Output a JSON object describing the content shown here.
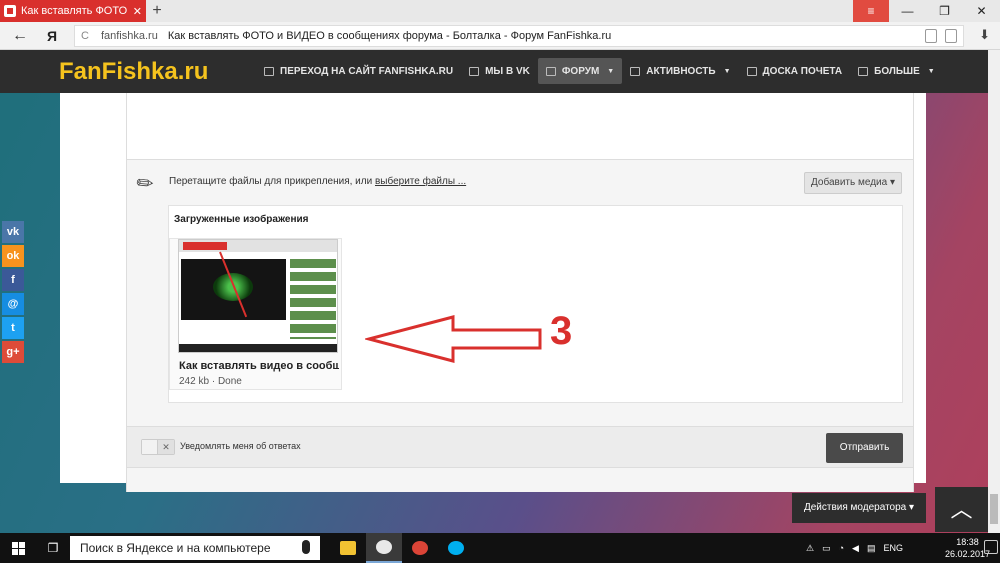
{
  "browser": {
    "tab_title": "Как вставлять ФОТО и ВИ",
    "new_tab": "+",
    "menu_glyph": "≡",
    "minimize_glyph": "—",
    "restore_glyph": "❐",
    "close_glyph": "✕",
    "back_glyph": "←",
    "yandex_glyph": "Я",
    "reload_glyph": "C",
    "domain": "fanfishka.ru",
    "page_title": "Как вставлять ФОТО и ВИДЕО в сообщениях форума - Болталка - Форум FanFishka.ru",
    "download_glyph": "⬇"
  },
  "site": {
    "logo": "FanFishka.ru",
    "nav": [
      {
        "label": "ПЕРЕХОД НА САЙТ FANFISHKA.RU",
        "icon": "monitor-icon",
        "caret": ""
      },
      {
        "label": "МЫ В VK",
        "icon": "vk-icon",
        "caret": ""
      },
      {
        "label": "ФОРУМ",
        "icon": "menu-icon",
        "caret": "▼"
      },
      {
        "label": "АКТИВНОСТЬ",
        "icon": "document-icon",
        "caret": "▼"
      },
      {
        "label": "ДОСКА ПОЧЕТА",
        "icon": "trophy-icon",
        "caret": ""
      },
      {
        "label": "БОЛЬШЕ",
        "icon": "menu-icon",
        "caret": "▼"
      }
    ]
  },
  "attach": {
    "drop_text": "Перетащите файлы для прикрепления, или",
    "choose_link": "выберите файлы ...",
    "add_media": "Добавить медиа ▾",
    "uploaded_title": "Загруженные изображения",
    "file": {
      "name": "Как вставлять видео в сообщ...",
      "size": "242 kb",
      "sep": "·",
      "status": "Done"
    }
  },
  "footer": {
    "toggle_glyph": "✕",
    "notify_label": "Уведомлять меня об ответах",
    "send": "Отправить"
  },
  "moderator_actions": "Действия модератора ▾",
  "to_top_glyph": "︿",
  "annotation_number": "3",
  "social": [
    {
      "icon": "vk-icon",
      "glyph": "vk",
      "color": "#4a76a8"
    },
    {
      "icon": "odnoklassniki-icon",
      "glyph": "ok",
      "color": "#f7931e"
    },
    {
      "icon": "facebook-icon",
      "glyph": "f",
      "color": "#3b5998"
    },
    {
      "icon": "mailru-icon",
      "glyph": "@",
      "color": "#168de2"
    },
    {
      "icon": "twitter-icon",
      "glyph": "t",
      "color": "#1da1f2"
    },
    {
      "icon": "googleplus-icon",
      "glyph": "g+",
      "color": "#dd4b39"
    }
  ],
  "taskbar": {
    "search_placeholder": "Поиск в Яндексе и на компьютере",
    "lang": "ENG",
    "time": "18:38",
    "date": "26.02.2017",
    "apps": [
      {
        "name": "file-explorer-icon",
        "color": "#f1c232"
      },
      {
        "name": "yandex-browser-icon",
        "color": "#e8e8e8"
      },
      {
        "name": "chrome-icon",
        "color": "#db4437"
      },
      {
        "name": "skype-icon",
        "color": "#00aff0"
      }
    ]
  }
}
